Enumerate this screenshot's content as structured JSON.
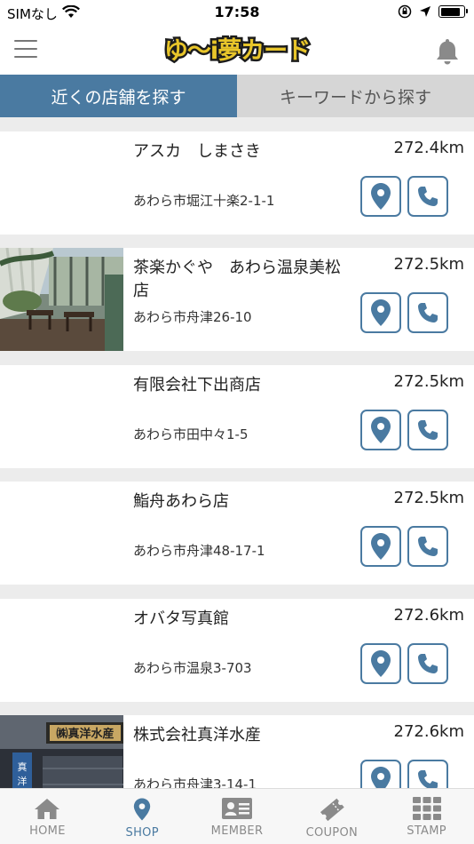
{
  "status_bar": {
    "carrier": "SIMなし",
    "time": "17:58",
    "battery_level": 0.85
  },
  "header": {
    "logo_text": "ゆ〜i夢カード"
  },
  "tabs": [
    {
      "label": "近くの店舗を探す",
      "active": true
    },
    {
      "label": "キーワードから探す",
      "active": false
    }
  ],
  "shops": [
    {
      "name": "アスカ　しまさき",
      "address": "あわら市堀江十楽2-1-1",
      "distance": "272.4km",
      "photo": false
    },
    {
      "name": "茶楽かぐや　あわら温泉美松店",
      "address": "あわら市舟津26-10",
      "distance": "272.5km",
      "photo": true
    },
    {
      "name": "有限会社下出商店",
      "address": "あわら市田中々1-5",
      "distance": "272.5km",
      "photo": false
    },
    {
      "name": "鮨舟あわら店",
      "address": "あわら市舟津48-17-1",
      "distance": "272.5km",
      "photo": false
    },
    {
      "name": "オバタ写真館",
      "address": "あわら市温泉3-703",
      "distance": "272.6km",
      "photo": false
    },
    {
      "name": "株式会社真洋水産",
      "address": "あわら市舟津3-14-1",
      "distance": "272.6km",
      "photo": true
    }
  ],
  "tab_bar": [
    {
      "label": "HOME",
      "icon": "home-icon",
      "active": false
    },
    {
      "label": "SHOP",
      "icon": "map-pin-icon",
      "active": true
    },
    {
      "label": "MEMBER",
      "icon": "member-card-icon",
      "active": false
    },
    {
      "label": "COUPON",
      "icon": "coupon-ticket-icon",
      "active": false
    },
    {
      "label": "STAMP",
      "icon": "stamp-grid-icon",
      "active": false
    }
  ],
  "colors": {
    "accent": "#4a7aa1",
    "inactive_tab_bg": "#d6d6d6",
    "logo_yellow": "#e8c52a"
  }
}
